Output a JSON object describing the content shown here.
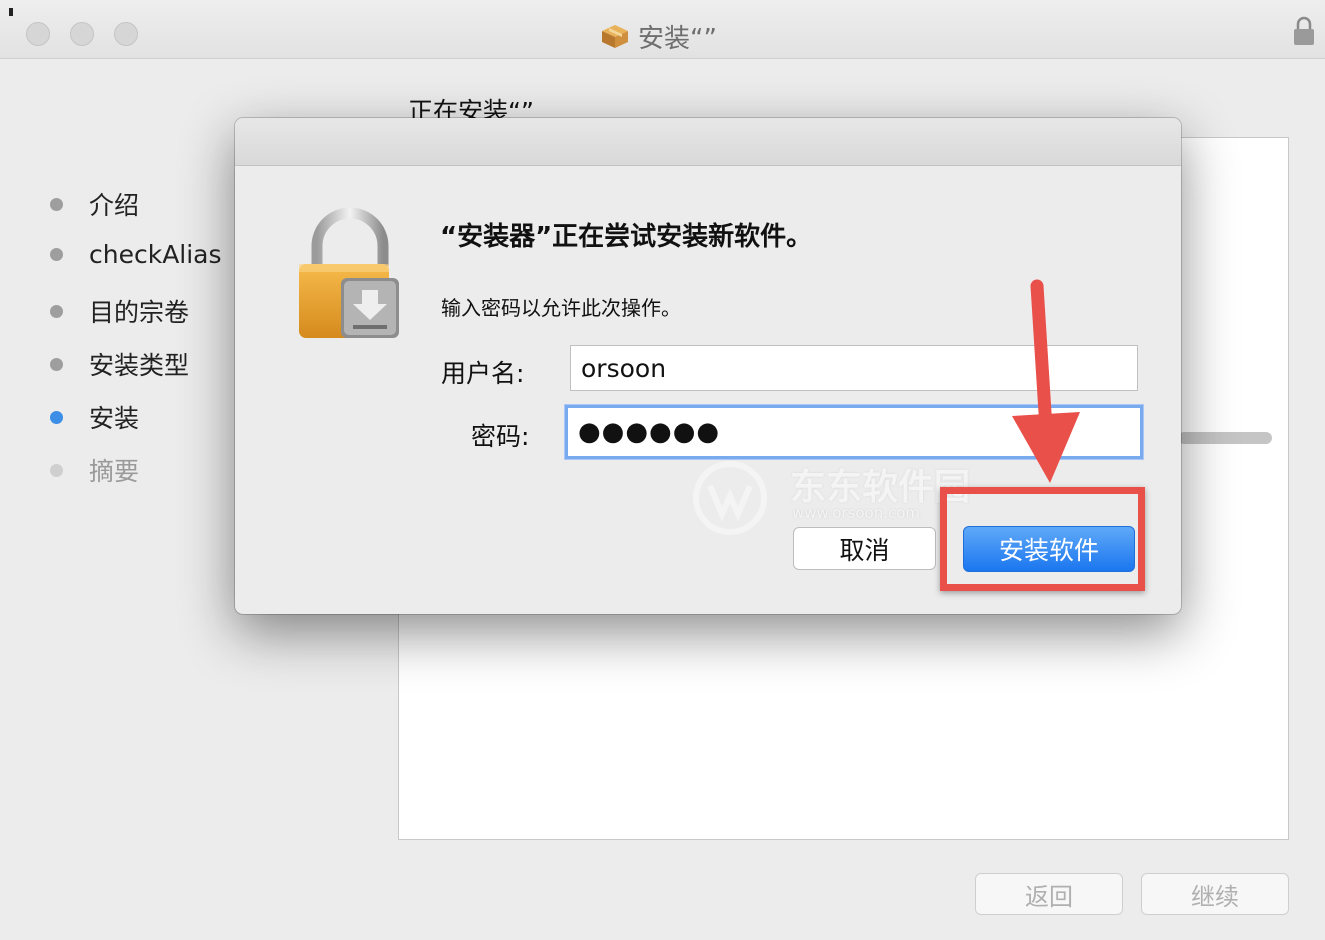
{
  "window": {
    "title": "安装“”",
    "icons": [
      "package-icon",
      "lock-icon"
    ]
  },
  "sidebar": {
    "steps": [
      {
        "label": "介绍",
        "state": "done"
      },
      {
        "label": "checkAlias",
        "state": "done"
      },
      {
        "label": "目的宗卷",
        "state": "done"
      },
      {
        "label": "安装类型",
        "state": "done"
      },
      {
        "label": "安装",
        "state": "active"
      },
      {
        "label": "摘要",
        "state": "pending"
      }
    ]
  },
  "main": {
    "heading": "正在安装“”"
  },
  "footer": {
    "back_label": "返回",
    "continue_label": "继续"
  },
  "dialog": {
    "title": "“安装器”正在尝试安装新软件。",
    "message": "输入密码以允许此次操作。",
    "username_label": "用户名:",
    "username_value": "orsoon",
    "password_label": "密码:",
    "password_value": "●●●●●●",
    "cancel_label": "取消",
    "install_label": "安装软件"
  },
  "watermark": {
    "text": "东东软件园",
    "sub": "www.orsoon.com"
  },
  "colors": {
    "accent": "#3d8ee6",
    "primary_button": "#1b76ef",
    "annotation": "#e9504a"
  }
}
